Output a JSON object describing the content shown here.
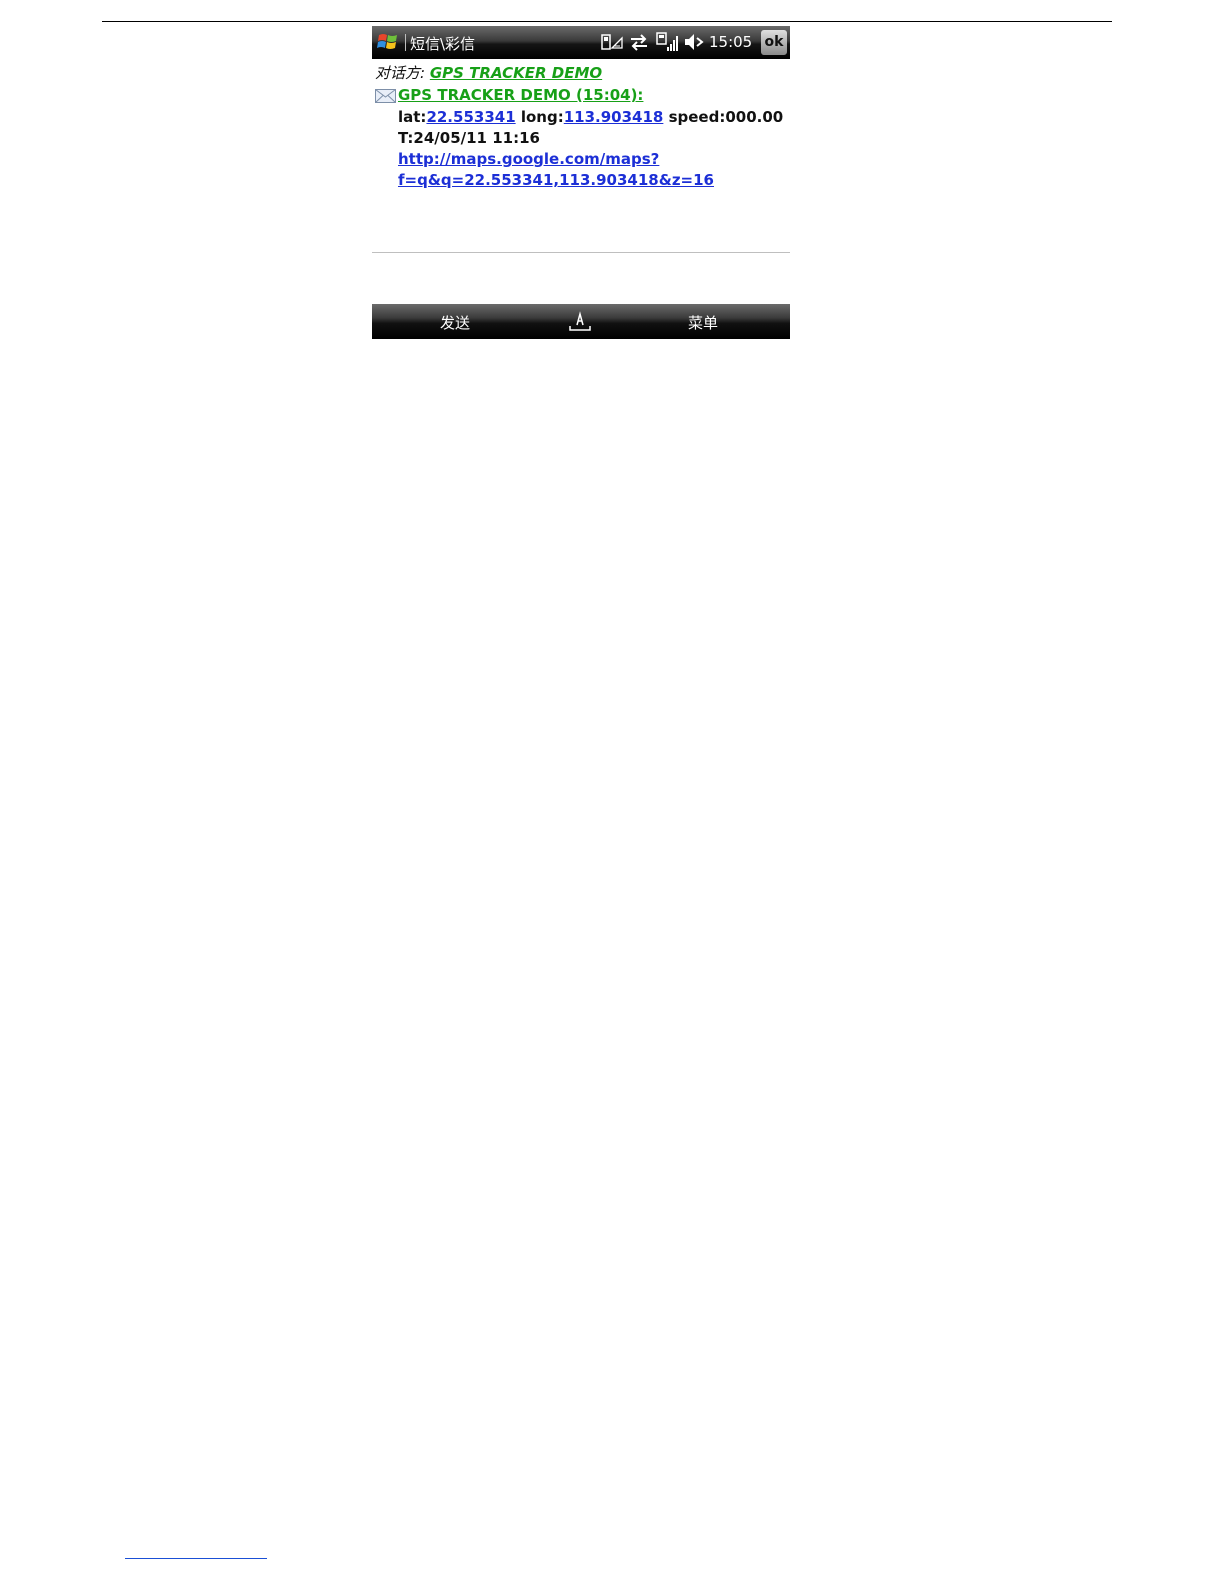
{
  "titlebar": {
    "app_title": "短信\\彩信",
    "clock": "15:05",
    "ok_label": "ok",
    "status_icons": [
      "phone-signal-icon",
      "data-transfer-icon",
      "signal-strength-icon",
      "speaker-muted-icon"
    ]
  },
  "conversation": {
    "recipient_label": "对话方:",
    "recipient_name": "GPS TRACKER DEMO",
    "message": {
      "header": "GPS TRACKER DEMO (15:04):",
      "lat_label": "lat:",
      "lat_value": "22.553341",
      "long_label": " long:",
      "long_value": "113.903418",
      "speed_text": " speed:000.00",
      "time_text": "T:24/05/11 11:16",
      "map_link_line1": "http://maps.google.com/maps?",
      "map_link_line2": "f=q&q=22.553341,113.903418&z=16"
    }
  },
  "softkeys": {
    "left": "发送",
    "right": "菜单",
    "center_icon": "keyboard-icon"
  },
  "colors": {
    "sender_green": "#17a017",
    "link_blue": "#1c2fd6"
  }
}
